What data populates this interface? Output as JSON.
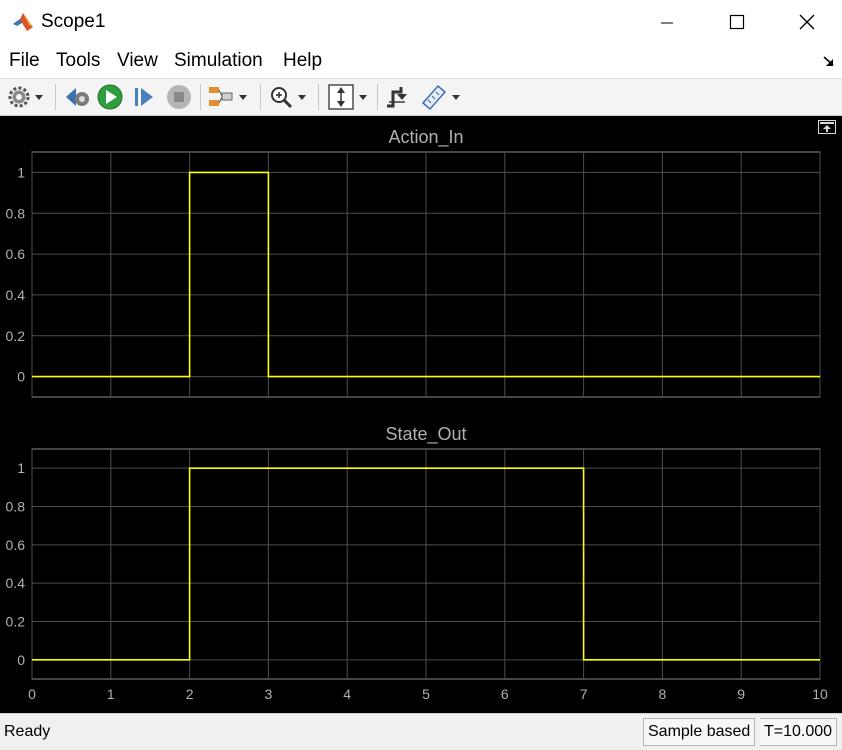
{
  "window": {
    "title": "Scope1"
  },
  "menu": {
    "file": "File",
    "tools": "Tools",
    "view": "View",
    "simulation": "Simulation",
    "help": "Help"
  },
  "toolbar": {
    "items": [
      "settings-icon",
      "step-back-icon",
      "run-icon",
      "step-forward-icon",
      "stop-icon",
      "signal-icon",
      "zoom-icon",
      "scale-icon",
      "trigger-icon",
      "measure-icon"
    ]
  },
  "status": {
    "left": "Ready",
    "mode": "Sample based",
    "time": "T=10.000"
  },
  "colors": {
    "signal": "#ffff00",
    "axes_bg": "#000000",
    "grid": "#4d4d4d",
    "axis_text": "#b0b0b0"
  },
  "chart_data": [
    {
      "type": "line",
      "title": "Action_In",
      "xlim": [
        0,
        10
      ],
      "ylim": [
        -0.1,
        1.1
      ],
      "yticks": [
        0,
        0.2,
        0.4,
        0.6,
        0.8,
        1
      ],
      "ytick_labels": [
        "0",
        "0.2",
        "0.4",
        "0.6",
        "0.8",
        "1"
      ],
      "xticks": [
        0,
        1,
        2,
        3,
        4,
        5,
        6,
        7,
        8,
        9,
        10
      ],
      "show_xtick_labels": false,
      "grid": true,
      "series": [
        {
          "x": [
            0,
            2,
            2,
            3,
            3,
            10
          ],
          "y": [
            0,
            0,
            1,
            1,
            0,
            0
          ]
        }
      ]
    },
    {
      "type": "line",
      "title": "State_Out",
      "xlim": [
        0,
        10
      ],
      "ylim": [
        -0.1,
        1.1
      ],
      "yticks": [
        0,
        0.2,
        0.4,
        0.6,
        0.8,
        1
      ],
      "ytick_labels": [
        "0",
        "0.2",
        "0.4",
        "0.6",
        "0.8",
        "1"
      ],
      "xticks": [
        0,
        1,
        2,
        3,
        4,
        5,
        6,
        7,
        8,
        9,
        10
      ],
      "xtick_labels": [
        "0",
        "1",
        "2",
        "3",
        "4",
        "5",
        "6",
        "7",
        "8",
        "9",
        "10"
      ],
      "show_xtick_labels": true,
      "grid": true,
      "series": [
        {
          "x": [
            0,
            2,
            2,
            7,
            7,
            10
          ],
          "y": [
            0,
            0,
            1,
            1,
            0,
            0
          ]
        }
      ]
    }
  ]
}
